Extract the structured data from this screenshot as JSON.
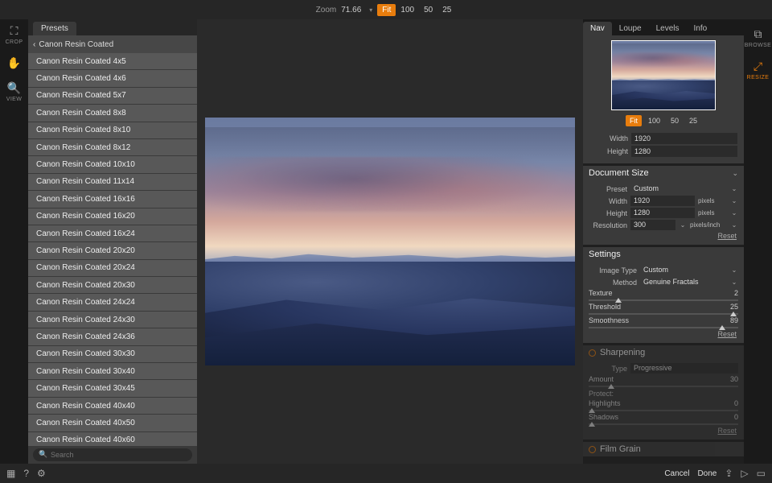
{
  "topbar": {
    "zoom_label": "Zoom",
    "zoom_value": "71.66",
    "buttons": [
      "Fit",
      "100",
      "50",
      "25"
    ],
    "active": "Fit"
  },
  "left_tools": [
    {
      "name": "crop",
      "icon": "⛶",
      "cap": "CROP"
    },
    {
      "name": "hand",
      "icon": "✋",
      "cap": ""
    },
    {
      "name": "view",
      "icon": "🔍",
      "cap": "VIEW"
    }
  ],
  "right_tools": [
    {
      "name": "browse",
      "icon": "⧉",
      "cap": "BROWSE",
      "active": false
    },
    {
      "name": "resize",
      "icon": "⤢",
      "cap": "RESIZE",
      "active": true
    }
  ],
  "presets": {
    "tab_label": "Presets",
    "header": "Canon Resin Coated",
    "search_placeholder": "Search",
    "items": [
      "Canon Resin Coated 4x5",
      "Canon Resin Coated 4x6",
      "Canon Resin Coated 5x7",
      "Canon Resin Coated 8x8",
      "Canon Resin Coated 8x10",
      "Canon Resin Coated 8x12",
      "Canon Resin Coated 10x10",
      "Canon Resin Coated 11x14",
      "Canon Resin Coated 16x16",
      "Canon Resin Coated 16x20",
      "Canon Resin Coated 16x24",
      "Canon Resin Coated 20x20",
      "Canon Resin Coated 20x24",
      "Canon Resin Coated 20x30",
      "Canon Resin Coated 24x24",
      "Canon Resin Coated 24x30",
      "Canon Resin Coated 24x36",
      "Canon Resin Coated 30x30",
      "Canon Resin Coated 30x40",
      "Canon Resin Coated 30x45",
      "Canon Resin Coated 40x40",
      "Canon Resin Coated 40x50",
      "Canon Resin Coated 40x60"
    ]
  },
  "nav": {
    "tabs": [
      "Nav",
      "Loupe",
      "Levels",
      "Info"
    ],
    "active": "Nav",
    "zoom_buttons": [
      "Fit",
      "100",
      "50",
      "25"
    ],
    "zoom_active": "Fit",
    "width_label": "Width",
    "width_value": "1920",
    "height_label": "Height",
    "height_value": "1280"
  },
  "document_size": {
    "title": "Document Size",
    "preset_label": "Preset",
    "preset_value": "Custom",
    "width_label": "Width",
    "width_value": "1920",
    "width_unit": "pixels",
    "height_label": "Height",
    "height_value": "1280",
    "height_unit": "pixels",
    "res_label": "Resolution",
    "res_value": "300",
    "res_unit": "pixels/inch",
    "reset": "Reset"
  },
  "settings": {
    "title": "Settings",
    "image_type_label": "Image Type",
    "image_type_value": "Custom",
    "method_label": "Method",
    "method_value": "Genuine Fractals",
    "texture_label": "Texture",
    "texture_value": 2,
    "threshold_label": "Threshold",
    "threshold_value": 25,
    "smoothness_label": "Smoothness",
    "smoothness_value": 89,
    "reset": "Reset"
  },
  "sharpening": {
    "title": "Sharpening",
    "type_label": "Type",
    "type_value": "Progressive",
    "amount_label": "Amount",
    "amount_value": 30,
    "protect_label": "Protect:",
    "highlights_label": "Highlights",
    "highlights_value": 0,
    "shadows_label": "Shadows",
    "shadows_value": 0,
    "reset": "Reset"
  },
  "film_grain": {
    "title": "Film Grain"
  },
  "bottom": {
    "cancel": "Cancel",
    "done": "Done"
  }
}
